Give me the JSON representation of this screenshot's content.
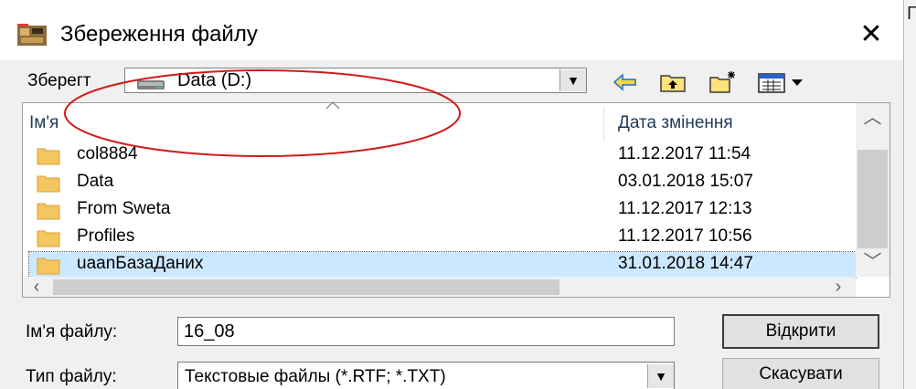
{
  "background_app": {
    "edge_text": "Г"
  },
  "dialog": {
    "title": "Збереження файлу",
    "close_glyph": "✕"
  },
  "toolbar": {
    "save_in_label": "Зберегт",
    "location": "Data (D:)",
    "icons": [
      "back-icon",
      "up-folder-icon",
      "new-folder-icon",
      "view-menu-icon"
    ]
  },
  "file_list": {
    "columns": {
      "name": "Ім'я",
      "date": "Дата змінення"
    },
    "rows": [
      {
        "name": "col8884",
        "date": "11.12.2017 11:54"
      },
      {
        "name": "Data",
        "date": "03.01.2018 15:07"
      },
      {
        "name": "From Sweta",
        "date": "11.12.2017 12:13"
      },
      {
        "name": "Profiles",
        "date": "11.12.2017 10:56"
      },
      {
        "name": "uaanБазаДаних",
        "date": "31.01.2018 14:47",
        "selected": true
      }
    ]
  },
  "form": {
    "filename_label": "Ім'я файлу:",
    "filename_value": "16_08",
    "filetype_label": "Тип файлу:",
    "filetype_value": "Текстовые файлы (*.RTF; *.TXT)"
  },
  "buttons": {
    "open": "Відкрити",
    "cancel": "Скасувати"
  },
  "colors": {
    "selection": "#cce8ff",
    "annotation": "#d11a1a",
    "folder": "#f3c65f"
  }
}
